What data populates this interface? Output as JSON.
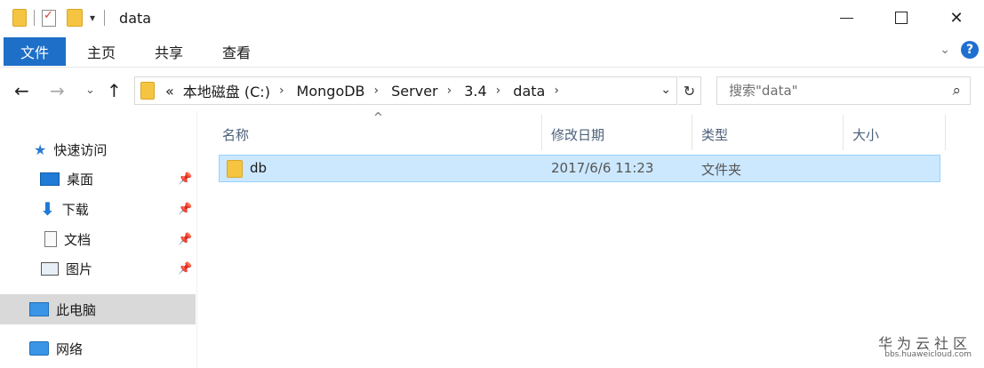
{
  "window": {
    "title": "data",
    "quick_access_icons": [
      "folder-icon",
      "properties-icon",
      "new-folder-icon",
      "customize-dropdown-icon"
    ]
  },
  "ribbon": {
    "tabs": [
      "文件",
      "主页",
      "共享",
      "查看"
    ]
  },
  "navigation": {
    "breadcrumb": [
      "«",
      "本地磁盘 (C:)",
      "MongoDB",
      "Server",
      "3.4",
      "data"
    ],
    "search_placeholder": "搜索\"data\""
  },
  "sidebar": {
    "items": [
      {
        "label": "快速访问",
        "icon": "star-icon",
        "pinned": false
      },
      {
        "label": "桌面",
        "icon": "desktop-icon",
        "pinned": true
      },
      {
        "label": "下载",
        "icon": "download-icon",
        "pinned": true
      },
      {
        "label": "文档",
        "icon": "document-icon",
        "pinned": true
      },
      {
        "label": "图片",
        "icon": "picture-icon",
        "pinned": true
      },
      {
        "label": "此电脑",
        "icon": "computer-icon",
        "pinned": false,
        "selected": true
      },
      {
        "label": "网络",
        "icon": "network-icon",
        "pinned": false
      }
    ]
  },
  "file_list": {
    "columns": [
      "名称",
      "修改日期",
      "类型",
      "大小"
    ],
    "rows": [
      {
        "name": "db",
        "modified": "2017/6/6 11:23",
        "type": "文件夹",
        "size": ""
      }
    ]
  },
  "watermark": {
    "brand": "华为云社区",
    "url": "bbs.huaweicloud.com"
  }
}
